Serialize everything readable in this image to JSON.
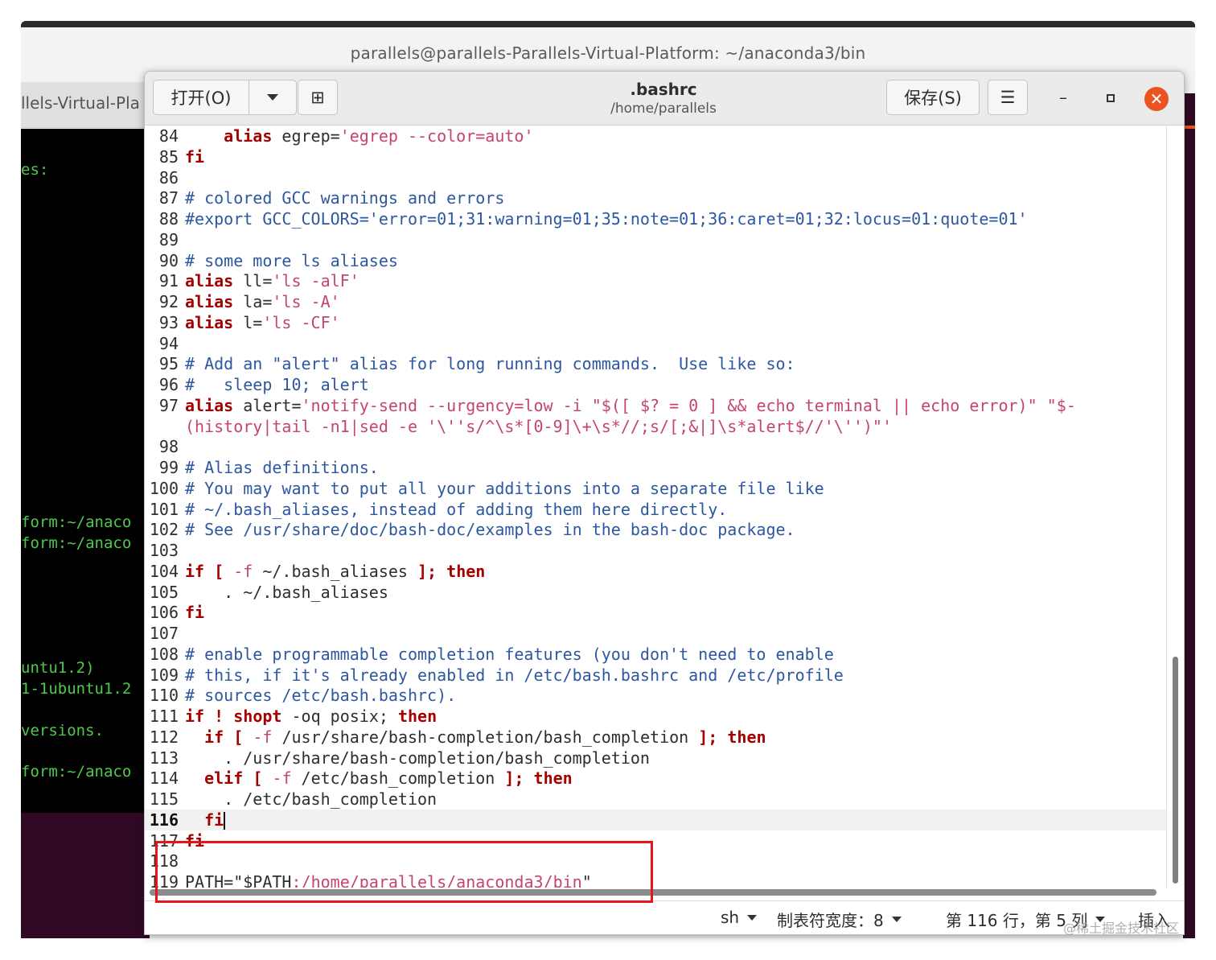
{
  "terminal": {
    "title": "parallels@parallels-Parallels-Virtual-Platform: ~/anaconda3/bin",
    "tab_label": "llels-Virtual-Pla",
    "visible_lines": [
      {
        "text": "es:",
        "color": "green"
      },
      {
        "text": "form:~/anaco",
        "color": "green"
      },
      {
        "text": "form:~/anaco",
        "color": "green"
      },
      {
        "text": "untu1.2)",
        "color": "green"
      },
      {
        "text": "1-1ubuntu1.2",
        "color": "green"
      },
      {
        "text": "versions.",
        "color": "green"
      },
      {
        "text": "form:~/anaco",
        "color": "green"
      }
    ]
  },
  "gedit": {
    "open_label": "打开(O)",
    "save_label": "保存(S)",
    "doc_title": ".bashrc",
    "doc_path": "/home/parallels",
    "menu_icon": "☰",
    "min_icon": "–",
    "close_icon": "✕",
    "new_tab_icon": "⊞"
  },
  "editor": {
    "current_line": "116",
    "lines": [
      {
        "n": "84",
        "segs": [
          {
            "t": "    ",
            "c": "pl"
          },
          {
            "t": "alias",
            "c": "kw"
          },
          {
            "t": " egrep=",
            "c": "pl"
          },
          {
            "t": "'egrep --color=auto'",
            "c": "st"
          }
        ]
      },
      {
        "n": "85",
        "segs": [
          {
            "t": "fi",
            "c": "kw"
          }
        ]
      },
      {
        "n": "86",
        "segs": []
      },
      {
        "n": "87",
        "segs": [
          {
            "t": "# colored GCC warnings and errors",
            "c": "cm"
          }
        ]
      },
      {
        "n": "88",
        "segs": [
          {
            "t": "#export GCC_COLORS='error=01;31:warning=01;35:note=01;36:caret=01;32:locus=01:quote=01'",
            "c": "cm"
          }
        ]
      },
      {
        "n": "89",
        "segs": []
      },
      {
        "n": "90",
        "segs": [
          {
            "t": "# some more ls aliases",
            "c": "cm"
          }
        ]
      },
      {
        "n": "91",
        "segs": [
          {
            "t": "alias",
            "c": "kw"
          },
          {
            "t": " ll=",
            "c": "pl"
          },
          {
            "t": "'ls -alF'",
            "c": "st"
          }
        ]
      },
      {
        "n": "92",
        "segs": [
          {
            "t": "alias",
            "c": "kw"
          },
          {
            "t": " la=",
            "c": "pl"
          },
          {
            "t": "'ls -A'",
            "c": "st"
          }
        ]
      },
      {
        "n": "93",
        "segs": [
          {
            "t": "alias",
            "c": "kw"
          },
          {
            "t": " l=",
            "c": "pl"
          },
          {
            "t": "'ls -CF'",
            "c": "st"
          }
        ]
      },
      {
        "n": "94",
        "segs": []
      },
      {
        "n": "95",
        "segs": [
          {
            "t": "# Add an \"alert\" alias for long running commands.  Use like so:",
            "c": "cm"
          }
        ]
      },
      {
        "n": "96",
        "segs": [
          {
            "t": "#   sleep 10; alert",
            "c": "cm"
          }
        ]
      },
      {
        "n": "97",
        "segs": [
          {
            "t": "alias",
            "c": "kw"
          },
          {
            "t": " alert=",
            "c": "pl"
          },
          {
            "t": "'notify-send --urgency=low -i \"$([ $? = 0 ] && echo terminal || echo error)\" \"$-",
            "c": "st"
          }
        ]
      },
      {
        "n": "",
        "segs": [
          {
            "t": "(history|tail -n1|sed -e '\\''s/^\\s*[0-9]\\+\\s*//;s/[;&|]\\s*alert$//'\\'')\"'",
            "c": "st"
          }
        ]
      },
      {
        "n": "98",
        "segs": []
      },
      {
        "n": "99",
        "segs": [
          {
            "t": "# Alias definitions.",
            "c": "cm"
          }
        ]
      },
      {
        "n": "100",
        "segs": [
          {
            "t": "# You may want to put all your additions into a separate file like",
            "c": "cm"
          }
        ]
      },
      {
        "n": "101",
        "segs": [
          {
            "t": "# ~/.bash_aliases, instead of adding them here directly.",
            "c": "cm"
          }
        ]
      },
      {
        "n": "102",
        "segs": [
          {
            "t": "# See /usr/share/doc/bash-doc/examples in the bash-doc package.",
            "c": "cm"
          }
        ]
      },
      {
        "n": "103",
        "segs": []
      },
      {
        "n": "104",
        "segs": [
          {
            "t": "if",
            "c": "kw"
          },
          {
            "t": " ",
            "c": "pl"
          },
          {
            "t": "[",
            "c": "kw"
          },
          {
            "t": " -f",
            "c": "st"
          },
          {
            "t": " ~/.bash_aliases ",
            "c": "pl"
          },
          {
            "t": "];",
            "c": "kw"
          },
          {
            "t": " ",
            "c": "pl"
          },
          {
            "t": "then",
            "c": "kw"
          }
        ]
      },
      {
        "n": "105",
        "segs": [
          {
            "t": "    . ~/.bash_aliases",
            "c": "pl"
          }
        ]
      },
      {
        "n": "106",
        "segs": [
          {
            "t": "fi",
            "c": "kw"
          }
        ]
      },
      {
        "n": "107",
        "segs": []
      },
      {
        "n": "108",
        "segs": [
          {
            "t": "# enable programmable completion features (you don't need to enable",
            "c": "cm"
          }
        ]
      },
      {
        "n": "109",
        "segs": [
          {
            "t": "# this, if it's already enabled in /etc/bash.bashrc and /etc/profile",
            "c": "cm"
          }
        ]
      },
      {
        "n": "110",
        "segs": [
          {
            "t": "# sources /etc/bash.bashrc).",
            "c": "cm"
          }
        ]
      },
      {
        "n": "111",
        "segs": [
          {
            "t": "if",
            "c": "kw"
          },
          {
            "t": " ",
            "c": "pl"
          },
          {
            "t": "!",
            "c": "kw"
          },
          {
            "t": " ",
            "c": "pl"
          },
          {
            "t": "shopt",
            "c": "kw"
          },
          {
            "t": " -oq posix; ",
            "c": "pl"
          },
          {
            "t": "then",
            "c": "kw"
          }
        ]
      },
      {
        "n": "112",
        "segs": [
          {
            "t": "  ",
            "c": "pl"
          },
          {
            "t": "if",
            "c": "kw"
          },
          {
            "t": " ",
            "c": "pl"
          },
          {
            "t": "[",
            "c": "kw"
          },
          {
            "t": " -f",
            "c": "st"
          },
          {
            "t": " /usr/share/bash-completion/bash_completion ",
            "c": "pl"
          },
          {
            "t": "];",
            "c": "kw"
          },
          {
            "t": " ",
            "c": "pl"
          },
          {
            "t": "then",
            "c": "kw"
          }
        ]
      },
      {
        "n": "113",
        "segs": [
          {
            "t": "    . /usr/share/bash-completion/bash_completion",
            "c": "pl"
          }
        ]
      },
      {
        "n": "114",
        "segs": [
          {
            "t": "  ",
            "c": "pl"
          },
          {
            "t": "elif",
            "c": "kw"
          },
          {
            "t": " ",
            "c": "pl"
          },
          {
            "t": "[",
            "c": "kw"
          },
          {
            "t": " -f",
            "c": "st"
          },
          {
            "t": " /etc/bash_completion ",
            "c": "pl"
          },
          {
            "t": "];",
            "c": "kw"
          },
          {
            "t": " ",
            "c": "pl"
          },
          {
            "t": "then",
            "c": "kw"
          }
        ]
      },
      {
        "n": "115",
        "segs": [
          {
            "t": "    . /etc/bash_completion",
            "c": "pl"
          }
        ]
      },
      {
        "n": "116",
        "segs": [
          {
            "t": "  ",
            "c": "pl"
          },
          {
            "t": "fi",
            "c": "kw"
          }
        ],
        "cursor": true
      },
      {
        "n": "117",
        "segs": [
          {
            "t": "fi",
            "c": "kw"
          }
        ]
      },
      {
        "n": "118",
        "segs": []
      },
      {
        "n": "119",
        "segs": [
          {
            "t": "PATH=",
            "c": "pl"
          },
          {
            "t": "\"",
            "c": "pl"
          },
          {
            "t": "$PATH",
            "c": "pl"
          },
          {
            "t": ":/home/parallels/anaconda3/bin",
            "c": "st"
          },
          {
            "t": "\"",
            "c": "pl"
          }
        ]
      }
    ]
  },
  "statusbar": {
    "language": "sh",
    "tab_width": "制表符宽度：8",
    "position": "第 116 行，第 5 列",
    "mode": "插入"
  },
  "watermark": "@稀土掘金技术社区",
  "colors": {
    "accent_close": "#e95420",
    "highlight_box": "#e4161b",
    "comment": "#2d57a0",
    "keyword": "#a40000",
    "string": "#c4466a"
  }
}
